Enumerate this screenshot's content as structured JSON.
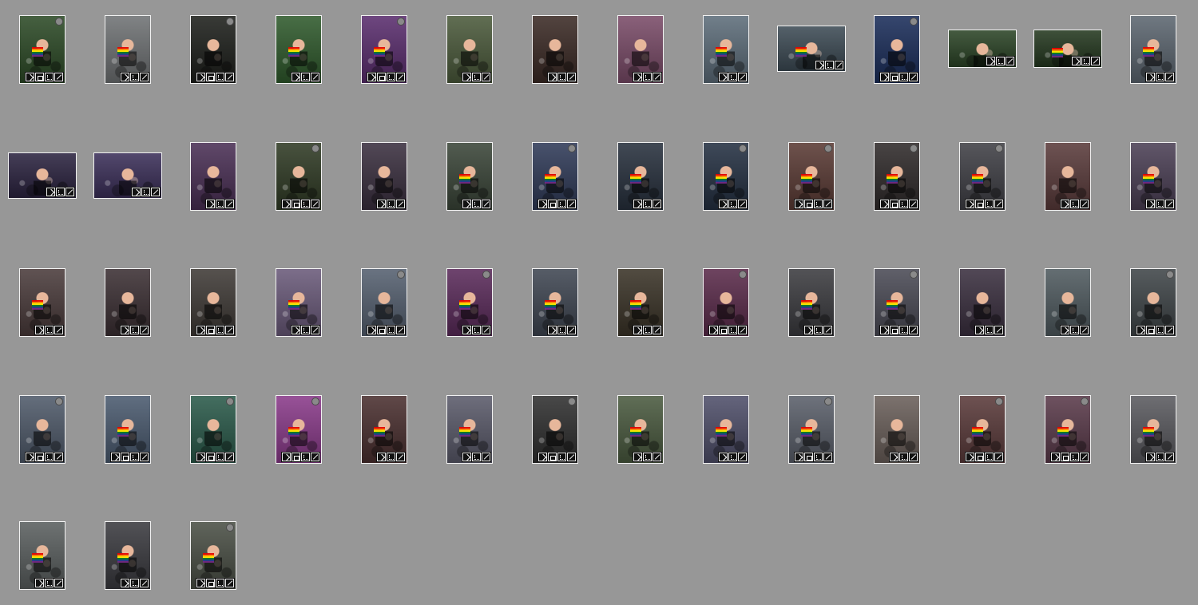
{
  "thumbnails": [
    {
      "o": "p",
      "badge": true,
      "stack": true,
      "bg": "#2c4a26",
      "flags": true
    },
    {
      "o": "p",
      "badge": false,
      "stack": false,
      "bg": "#6f7274",
      "flags": true
    },
    {
      "o": "p",
      "badge": true,
      "stack": true,
      "bg": "#1d1f1b",
      "flags": false
    },
    {
      "o": "p",
      "badge": false,
      "stack": false,
      "bg": "#2f5a2c",
      "flags": true
    },
    {
      "o": "p",
      "badge": true,
      "stack": true,
      "bg": "#5a2d6e",
      "flags": true
    },
    {
      "o": "p",
      "badge": false,
      "stack": false,
      "bg": "#4b5a3b",
      "flags": false
    },
    {
      "o": "p",
      "badge": false,
      "stack": false,
      "bg": "#3b2a25",
      "flags": false
    },
    {
      "o": "p",
      "badge": false,
      "stack": false,
      "bg": "#7a4b68",
      "flags": false
    },
    {
      "o": "p",
      "badge": false,
      "stack": false,
      "bg": "#5d6d7a",
      "flags": true
    },
    {
      "o": "l",
      "badge": false,
      "stack": false,
      "bg": "#3d4b55",
      "flags": true
    },
    {
      "o": "p",
      "badge": true,
      "stack": true,
      "bg": "#1a2d5a",
      "flags": false
    },
    {
      "o": "l",
      "badge": false,
      "stack": false,
      "bg": "#2b4426",
      "flags": false
    },
    {
      "o": "l",
      "badge": false,
      "stack": false,
      "bg": "#24381f",
      "flags": true
    },
    {
      "o": "p",
      "badge": false,
      "stack": false,
      "bg": "#5c6670",
      "flags": true
    },
    {
      "o": "l",
      "badge": false,
      "stack": false,
      "bg": "#2b2340",
      "flags": false
    },
    {
      "o": "l",
      "badge": false,
      "stack": false,
      "bg": "#3b2f59",
      "flags": false
    },
    {
      "o": "p",
      "badge": false,
      "stack": false,
      "bg": "#4a2f55",
      "flags": false
    },
    {
      "o": "p",
      "badge": true,
      "stack": true,
      "bg": "#2f3a24",
      "flags": false
    },
    {
      "o": "p",
      "badge": false,
      "stack": false,
      "bg": "#3a2f3f",
      "flags": false
    },
    {
      "o": "p",
      "badge": false,
      "stack": false,
      "bg": "#3a4538",
      "flags": true
    },
    {
      "o": "p",
      "badge": true,
      "stack": true,
      "bg": "#2f3a58",
      "flags": true
    },
    {
      "o": "p",
      "badge": false,
      "stack": false,
      "bg": "#27303d",
      "flags": true
    },
    {
      "o": "p",
      "badge": true,
      "stack": false,
      "bg": "#243042",
      "flags": true
    },
    {
      "o": "p",
      "badge": true,
      "stack": true,
      "bg": "#5a3a34",
      "flags": true
    },
    {
      "o": "p",
      "badge": true,
      "stack": true,
      "bg": "#2f2a2a",
      "flags": true
    },
    {
      "o": "p",
      "badge": true,
      "stack": true,
      "bg": "#3f3f45",
      "flags": true
    },
    {
      "o": "p",
      "badge": false,
      "stack": false,
      "bg": "#5a3b3b",
      "flags": false
    },
    {
      "o": "p",
      "badge": false,
      "stack": false,
      "bg": "#4b3f55",
      "flags": true
    },
    {
      "o": "p",
      "badge": false,
      "stack": false,
      "bg": "#4a3b3b",
      "flags": true
    },
    {
      "o": "p",
      "badge": false,
      "stack": false,
      "bg": "#3b2f33",
      "flags": false
    },
    {
      "o": "p",
      "badge": false,
      "stack": true,
      "bg": "#3f3a36",
      "flags": false
    },
    {
      "o": "p",
      "badge": false,
      "stack": false,
      "bg": "#6a5a7a",
      "flags": true
    },
    {
      "o": "p",
      "badge": true,
      "stack": true,
      "bg": "#556070",
      "flags": false
    },
    {
      "o": "p",
      "badge": true,
      "stack": false,
      "bg": "#5a2a5a",
      "flags": true
    },
    {
      "o": "p",
      "badge": false,
      "stack": false,
      "bg": "#3f4652",
      "flags": true
    },
    {
      "o": "p",
      "badge": false,
      "stack": false,
      "bg": "#3a3327",
      "flags": true
    },
    {
      "o": "p",
      "badge": true,
      "stack": true,
      "bg": "#5a2a4a",
      "flags": false
    },
    {
      "o": "p",
      "badge": false,
      "stack": false,
      "bg": "#3b3b3f",
      "flags": true
    },
    {
      "o": "p",
      "badge": true,
      "stack": true,
      "bg": "#4a4a55",
      "flags": true
    },
    {
      "o": "p",
      "badge": false,
      "stack": false,
      "bg": "#3a2f3f",
      "flags": false
    },
    {
      "o": "p",
      "badge": false,
      "stack": false,
      "bg": "#4f5a5f",
      "flags": false
    },
    {
      "o": "p",
      "badge": true,
      "stack": true,
      "bg": "#3f4548",
      "flags": false
    },
    {
      "o": "p",
      "badge": true,
      "stack": true,
      "bg": "#4f5a6a",
      "flags": false
    },
    {
      "o": "p",
      "badge": false,
      "stack": true,
      "bg": "#4a5a6f",
      "flags": true
    },
    {
      "o": "p",
      "badge": true,
      "stack": true,
      "bg": "#2a5a4a",
      "flags": false
    },
    {
      "o": "p",
      "badge": true,
      "stack": true,
      "bg": "#8a3a8a",
      "flags": true
    },
    {
      "o": "p",
      "badge": false,
      "stack": false,
      "bg": "#4a2f2f",
      "flags": true
    },
    {
      "o": "p",
      "badge": false,
      "stack": false,
      "bg": "#5a5a6a",
      "flags": true
    },
    {
      "o": "p",
      "badge": true,
      "stack": true,
      "bg": "#2f2f2f",
      "flags": false
    },
    {
      "o": "p",
      "badge": false,
      "stack": false,
      "bg": "#4a5a3f",
      "flags": true
    },
    {
      "o": "p",
      "badge": false,
      "stack": false,
      "bg": "#4f4f6a",
      "flags": true
    },
    {
      "o": "p",
      "badge": true,
      "stack": true,
      "bg": "#5a5f6a",
      "flags": true
    },
    {
      "o": "p",
      "badge": false,
      "stack": false,
      "bg": "#6a5f5a",
      "flags": false
    },
    {
      "o": "p",
      "badge": true,
      "stack": true,
      "bg": "#5a3a3a",
      "flags": true
    },
    {
      "o": "p",
      "badge": true,
      "stack": true,
      "bg": "#5a3a4a",
      "flags": true
    },
    {
      "o": "p",
      "badge": false,
      "stack": false,
      "bg": "#5a5a5f",
      "flags": true
    },
    {
      "o": "p",
      "badge": false,
      "stack": false,
      "bg": "#5a5f5f",
      "flags": true
    },
    {
      "o": "p",
      "badge": false,
      "stack": false,
      "bg": "#3a3a3f",
      "flags": true
    },
    {
      "o": "p",
      "badge": true,
      "stack": true,
      "bg": "#4a4f45",
      "flags": true
    }
  ]
}
